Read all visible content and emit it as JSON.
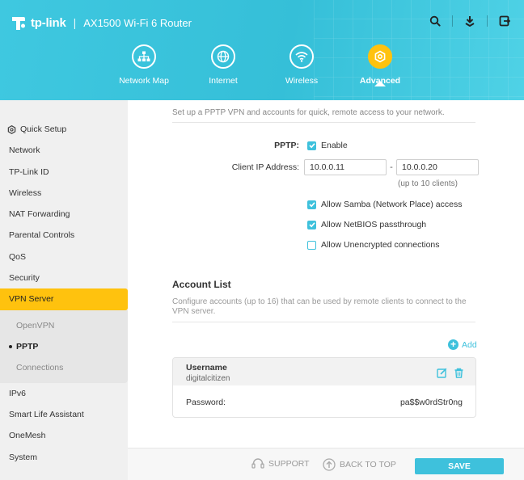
{
  "header": {
    "brand": "tp-link",
    "separator": "|",
    "model": "AX1500 Wi-Fi 6 Router",
    "icons": [
      "search-icon",
      "download-icon",
      "logout-icon"
    ]
  },
  "nav": [
    {
      "label": "Network Map",
      "icon": "network-map-icon"
    },
    {
      "label": "Internet",
      "icon": "globe-icon"
    },
    {
      "label": "Wireless",
      "icon": "wifi-icon"
    },
    {
      "label": "Advanced",
      "icon": "gear-icon",
      "active": true
    }
  ],
  "sidebar": {
    "items": [
      {
        "label": "Quick Setup"
      },
      {
        "label": "Network"
      },
      {
        "label": "TP-Link ID"
      },
      {
        "label": "Wireless"
      },
      {
        "label": "NAT Forwarding"
      },
      {
        "label": "Parental Controls"
      },
      {
        "label": "QoS"
      },
      {
        "label": "Security"
      },
      {
        "label": "VPN Server"
      },
      {
        "label": "IPv6"
      },
      {
        "label": "Smart Life Assistant"
      },
      {
        "label": "OneMesh"
      },
      {
        "label": "System"
      }
    ],
    "vpn_sub": [
      {
        "label": "OpenVPN"
      },
      {
        "label": "PPTP"
      },
      {
        "label": "Connections"
      }
    ]
  },
  "main": {
    "intro": "Set up a PPTP VPN and accounts for quick, remote access to your network.",
    "pptp_label": "PPTP:",
    "pptp_enable": "Enable",
    "client_ip_label": "Client IP Address:",
    "ip_start": "10.0.0.11",
    "ip_dash": "-",
    "ip_end": "10.0.0.20",
    "ip_hint": "(up to 10 clients)",
    "opt_samba": "Allow Samba (Network Place) access",
    "opt_netbios": "Allow NetBIOS passthrough",
    "opt_unencrypted": "Allow Unencrypted connections",
    "account_title": "Account List",
    "account_desc": "Configure accounts (up to 16) that can be used by remote clients to connect to the VPN server.",
    "add_label": "Add",
    "account": {
      "username_label": "Username",
      "username": "digitalcitizen",
      "password_label": "Password:",
      "password": "pa$$w0rdStr0ng"
    }
  },
  "footer": {
    "support": "SUPPORT",
    "back_to_top": "BACK TO TOP",
    "save": "SAVE"
  },
  "colors": {
    "accent": "#3ec1dc",
    "highlight": "#ffc20e",
    "header": "#3fc8e0"
  }
}
